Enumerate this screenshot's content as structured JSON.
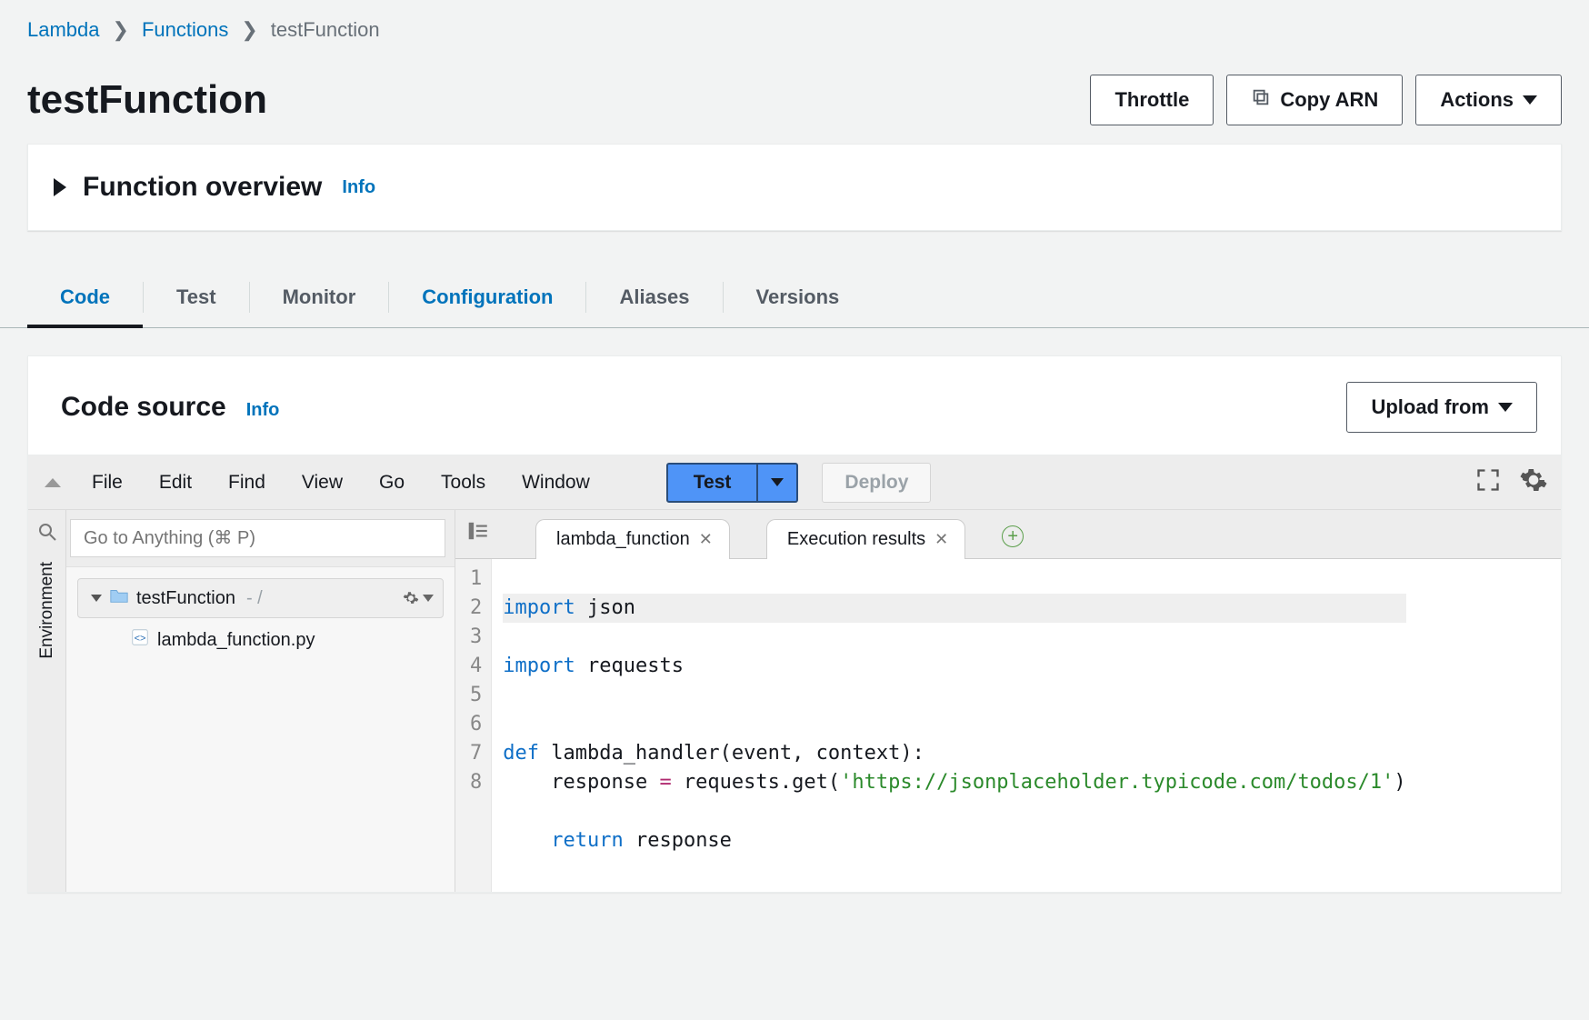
{
  "breadcrumb": {
    "lambda": "Lambda",
    "functions": "Functions",
    "current": "testFunction"
  },
  "pageTitle": "testFunction",
  "headerButtons": {
    "throttle": "Throttle",
    "copyArn": "Copy ARN",
    "actions": "Actions"
  },
  "overview": {
    "title": "Function overview",
    "info": "Info"
  },
  "tabs": {
    "code": "Code",
    "test": "Test",
    "monitor": "Monitor",
    "configuration": "Configuration",
    "aliases": "Aliases",
    "versions": "Versions"
  },
  "codeSource": {
    "title": "Code source",
    "info": "Info",
    "uploadFrom": "Upload from"
  },
  "ideMenu": {
    "file": "File",
    "edit": "Edit",
    "find": "Find",
    "view": "View",
    "go": "Go",
    "tools": "Tools",
    "window": "Window",
    "test": "Test",
    "deploy": "Deploy"
  },
  "gotoPlaceholder": "Go to Anything (⌘ P)",
  "sidebar": {
    "environment": "Environment",
    "project": "testFunction",
    "projectSuffix": "- /",
    "file": "lambda_function.py"
  },
  "editorTabs": {
    "main": "lambda_function",
    "results": "Execution results"
  },
  "codeLines": {
    "l1a": "import",
    "l1b": " json",
    "l2a": "import",
    "l2b": " requests",
    "l3": "",
    "l4": "",
    "l5a": "def",
    "l5b": " lambda_handler(event, context):",
    "l6a": "    response ",
    "l6op": "=",
    "l6b": " requests.get(",
    "l6s": "'https://jsonplaceholder.typicode.com/todos/1'",
    "l6c": ")",
    "l7": "",
    "l8a": "    ",
    "l8b": "return",
    "l8c": " response"
  },
  "lineNumbers": [
    "1",
    "2",
    "3",
    "4",
    "5",
    "6",
    "7",
    "8"
  ]
}
